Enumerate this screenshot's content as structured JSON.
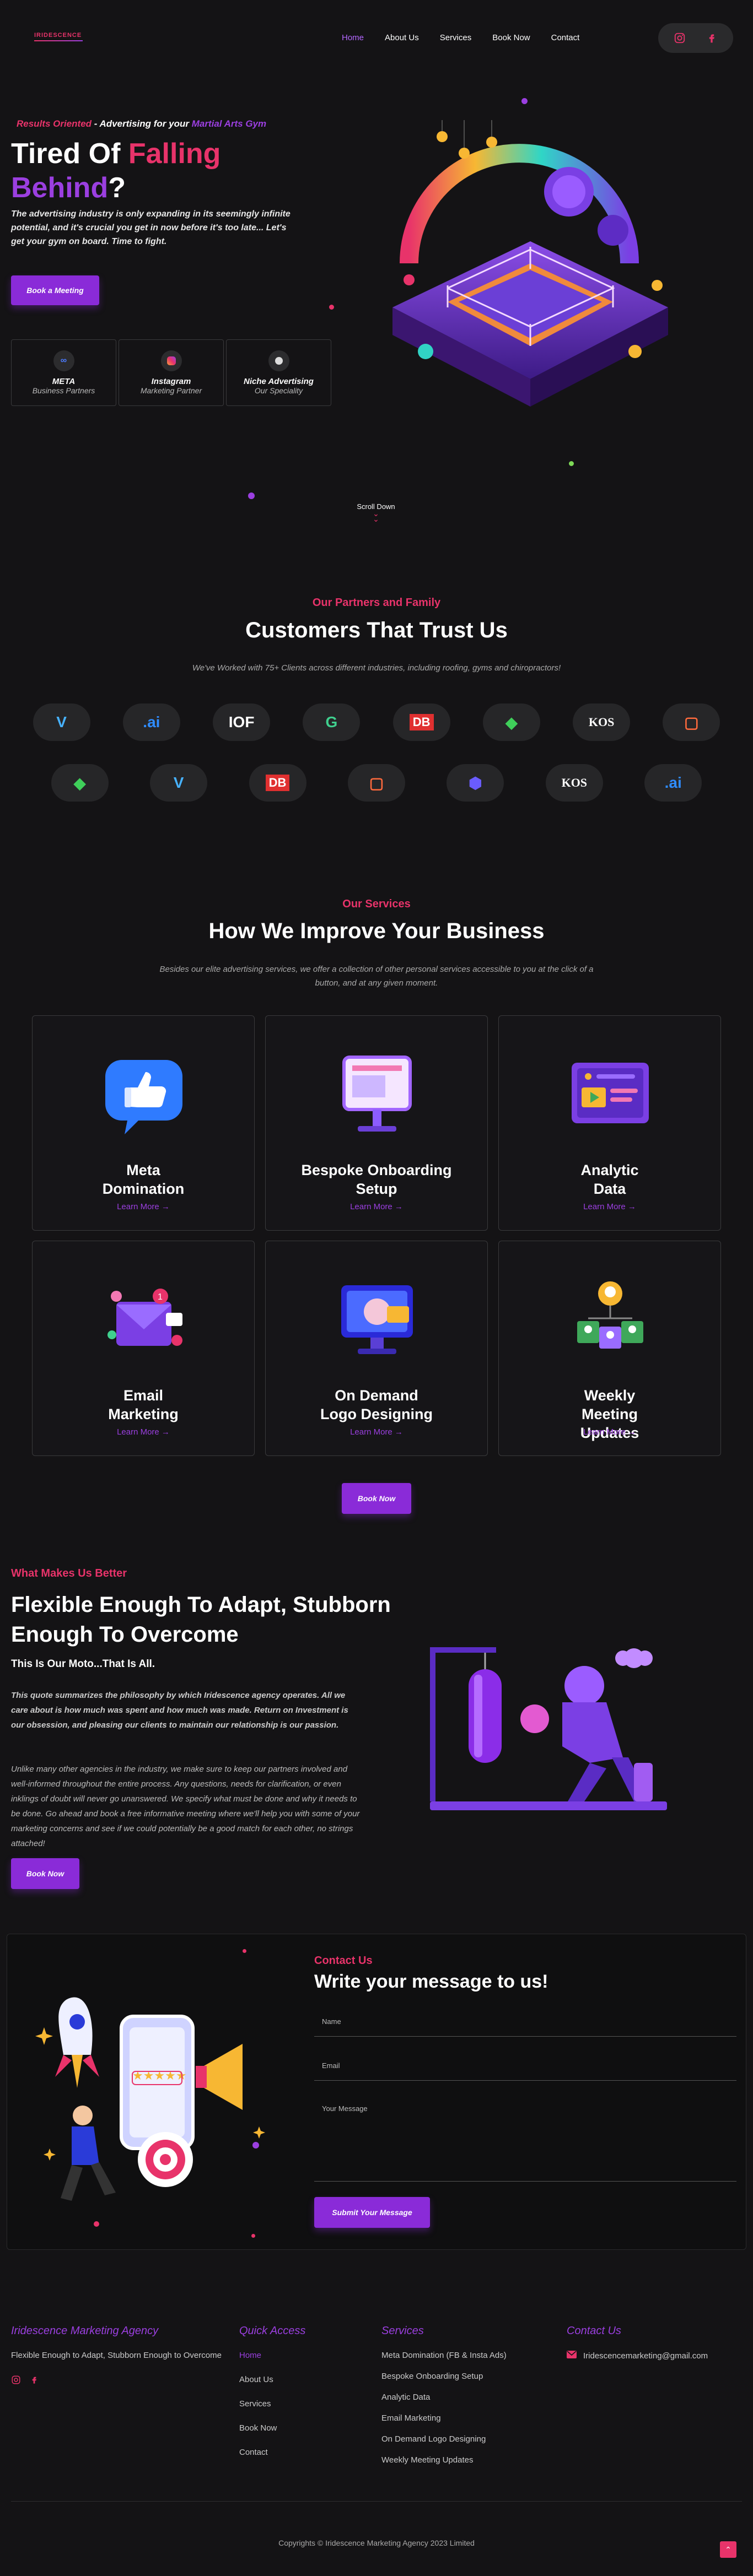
{
  "brand": {
    "name": "IRIDESCENCE"
  },
  "nav": {
    "items": [
      {
        "label": "Home"
      },
      {
        "label": "About Us"
      },
      {
        "label": "Services"
      },
      {
        "label": "Book Now"
      },
      {
        "label": "Contact"
      }
    ],
    "active": "Home"
  },
  "hero": {
    "tag_a": "Results Oriented",
    "tag_b": " - Advertising for your ",
    "tag_c": "Martial Arts Gym",
    "title_a": "Tired Of ",
    "title_b": "Falling",
    "title_c": "Behind",
    "title_d": "?",
    "desc": "The advertising industry is only expanding in its seemingly infinite potential, and it's crucial you get in now before it's too late... Let's get your gym on board. Time to fight.",
    "cta": "Book a Meeting",
    "badges": [
      {
        "title": "META",
        "sub": "Business Partners",
        "icon": "meta-icon"
      },
      {
        "title": "Instagram",
        "sub": "Marketing Partner",
        "icon": "instagram-icon"
      },
      {
        "title": "Niche Advertising",
        "sub": "Our Speciality",
        "icon": "target-icon"
      }
    ],
    "scroll": "Scroll Down"
  },
  "partners": {
    "kicker": "Our Partners and Family",
    "title": "Customers That Trust Us",
    "sub": "We've Worked with 75+ Clients across different industries, including roofing, gyms and chiropractors!",
    "row1": [
      "V",
      ".ai",
      "IOF",
      "G",
      "DB",
      "◆",
      "KOS",
      "▢"
    ],
    "row2": [
      "◆",
      "V",
      "DB",
      "▢",
      "⬢",
      "KOS",
      ".ai"
    ]
  },
  "services": {
    "kicker": "Our Services",
    "title": "How We Improve Your Business",
    "sub": "Besides our elite advertising services, we offer a collection of other personal services accessible to you at the click of a button, and at any given moment.",
    "learn_more": "Learn More →",
    "items": [
      {
        "title": "Meta Domination"
      },
      {
        "title": "Bespoke Onboarding Setup"
      },
      {
        "title": "Analytic Data"
      },
      {
        "title": "Email Marketing"
      },
      {
        "title": "On Demand Logo Designing"
      },
      {
        "title": "Weekly Meeting Updates"
      }
    ],
    "cta": "Book Now"
  },
  "about": {
    "kicker": "What Makes Us Better",
    "title": "Flexible Enough To Adapt, Stubborn Enough To Overcome",
    "moto": "This Is Our Moto...That Is All.",
    "p1": "This quote summarizes the philosophy by which Iridescence agency operates. All we care about is how much was spent and how much was made. Return on Investment is our obsession, and pleasing our clients to maintain our relationship is our passion.",
    "p2": "Unlike many other agencies in the industry, we make sure to keep our partners involved and well-informed throughout the entire process. Any questions, needs for clarification, or even inklings of doubt will never go unanswered. We specify what must be done and why it needs to be done. Go ahead and book a free informative meeting where we'll help you with some of your marketing concerns and see if we could potentially be a good match for each other, no strings attached!",
    "cta": "Book Now"
  },
  "contact": {
    "kicker": "Contact Us",
    "title": "Write your message to us!",
    "name_ph": "Name",
    "email_ph": "Email",
    "msg_ph": "Your Message",
    "submit": "Submit Your Message"
  },
  "footer": {
    "brand": "Iridescence Marketing Agency",
    "tagline": "Flexible Enough to Adapt, Stubborn Enough to Overcome",
    "quick_title": "Quick Access",
    "quick": [
      "Home",
      "About Us",
      "Services",
      "Book Now",
      "Contact"
    ],
    "services_title": "Services",
    "services": [
      "Meta Domination (FB & Insta Ads)",
      "Bespoke Onboarding Setup",
      "Analytic Data",
      "Email Marketing",
      "On Demand Logo Designing",
      "Weekly Meeting Updates"
    ],
    "contact_title": "Contact Us",
    "email": "Iridescencemarketing@gmail.com",
    "copyright": "Copyrights © Iridescence Marketing Agency 2023 Limited"
  },
  "colors": {
    "accent_pink": "#e8336a",
    "accent_purple": "#9b3fe0",
    "background": "#141315"
  }
}
